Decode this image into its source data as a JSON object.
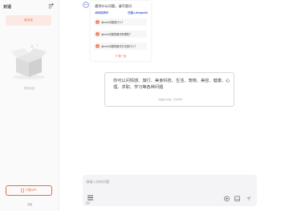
{
  "sidebar": {
    "title": "对话",
    "new_chat_label": "新对话",
    "empty_text": "暂无对话~",
    "download_label": "下载APP",
    "settings_label": "设置"
  },
  "intro": {
    "title": "遇到什么问题，请尽管问",
    "subtitle": "试试这样问",
    "brand": "已接入deepseek",
    "questions": [
      {
        "text": "iphone问题是什么？"
      },
      {
        "text": "iphone问题的解决有哪些？"
      },
      {
        "text": "iphone问题的解决方法是什么？"
      }
    ],
    "refresh_label": "换一批"
  },
  "capabilities": {
    "text": "你可以问情感、旅行、美食科技、生活、宠物、美容、健康、心理、求职、学习等各种问题",
    "note": "内容由AI生成，仅作参考"
  },
  "input": {
    "placeholder": "请输入你的问题",
    "menu_label": "指令"
  },
  "colors": {
    "accent": "#e86a4c",
    "brand_blue": "#3a59c9"
  }
}
